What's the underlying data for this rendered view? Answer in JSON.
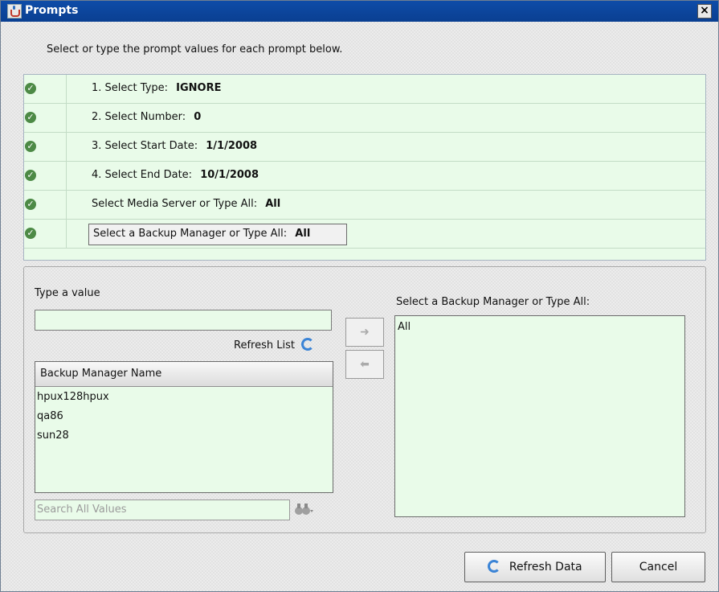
{
  "window": {
    "title": "Prompts",
    "close_label": "×",
    "instruction": "Select or type the prompt values for each prompt below."
  },
  "prompts": [
    {
      "label": "1. Select Type:",
      "value": "IGNORE"
    },
    {
      "label": "2. Select Number:",
      "value": "0"
    },
    {
      "label": "3. Select Start Date:",
      "value": "1/1/2008"
    },
    {
      "label": "4. Select End Date:",
      "value": "10/1/2008"
    },
    {
      "label": "Select Media Server or Type All:",
      "value": "All"
    },
    {
      "label": "Select a Backup Manager or Type All:",
      "value": "All"
    }
  ],
  "editor": {
    "type_label": "Type a value",
    "refresh_list_label": "Refresh List",
    "list_header": "Backup Manager Name",
    "list_items": [
      "hpux128hpux",
      "qa86",
      "sun28"
    ],
    "search_placeholder": "Search All Values",
    "selected_label": "Select a Backup Manager or Type All:",
    "selected_values": [
      "All"
    ],
    "add_arrow": "➜",
    "remove_arrow": "⬅"
  },
  "buttons": {
    "refresh_data": "Refresh Data",
    "cancel": "Cancel"
  }
}
